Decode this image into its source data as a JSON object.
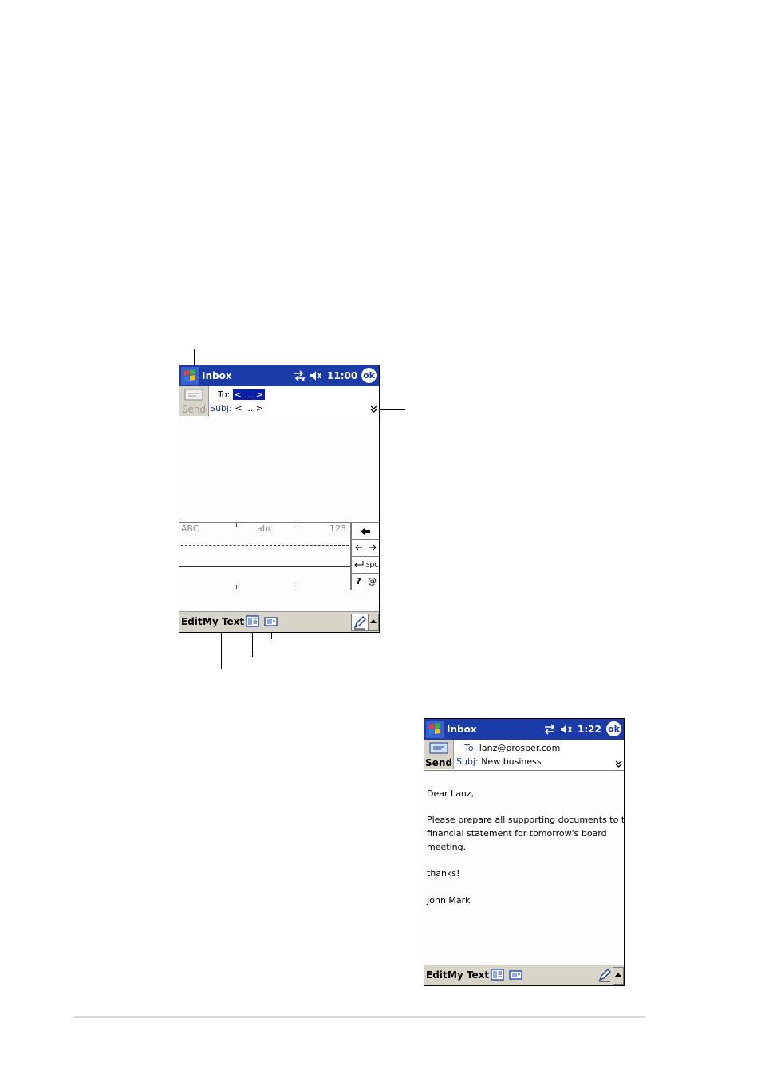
{
  "screen1": {
    "title": "Inbox",
    "time": "11:00",
    "ok_label": "ok",
    "send_label": "Send",
    "to_label": "To:",
    "to_value": "< ... >",
    "subj_label": "Subj:",
    "subj_value": "< ... >",
    "keyboard": {
      "label_caps": "ABC",
      "label_lower": "abc",
      "label_num": "123",
      "key_space": "spc",
      "key_question": "?",
      "key_at": "@"
    },
    "menu": {
      "edit": "Edit",
      "my_text": "My Text"
    }
  },
  "screen2": {
    "title": "Inbox",
    "time": "1:22",
    "ok_label": "ok",
    "send_label": "Send",
    "to_label": "To:",
    "to_value": "lanz@prosper.com",
    "subj_label": "Subj:",
    "subj_value": "New business",
    "body_lines": [
      "Dear Lanz,",
      "Please prepare all supporting documents to the",
      "financial statement for tomorrow's board",
      "meeting.",
      "thanks!",
      "John Mark"
    ],
    "menu": {
      "edit": "Edit",
      "my_text": "My Text"
    }
  },
  "icons": {
    "start": "windows-flag-icon",
    "connectivity": "connectivity-icon",
    "volume": "speaker-icon",
    "send": "envelope-icon",
    "expand": "chevron-down-icon",
    "address_book": "address-book-icon",
    "attachment": "attachment-icon",
    "input_panel": "pen-icon"
  },
  "colors": {
    "titlebar": "#1b3ba8",
    "menubar": "#d8d4c8",
    "selection": "#0a1fa8"
  }
}
